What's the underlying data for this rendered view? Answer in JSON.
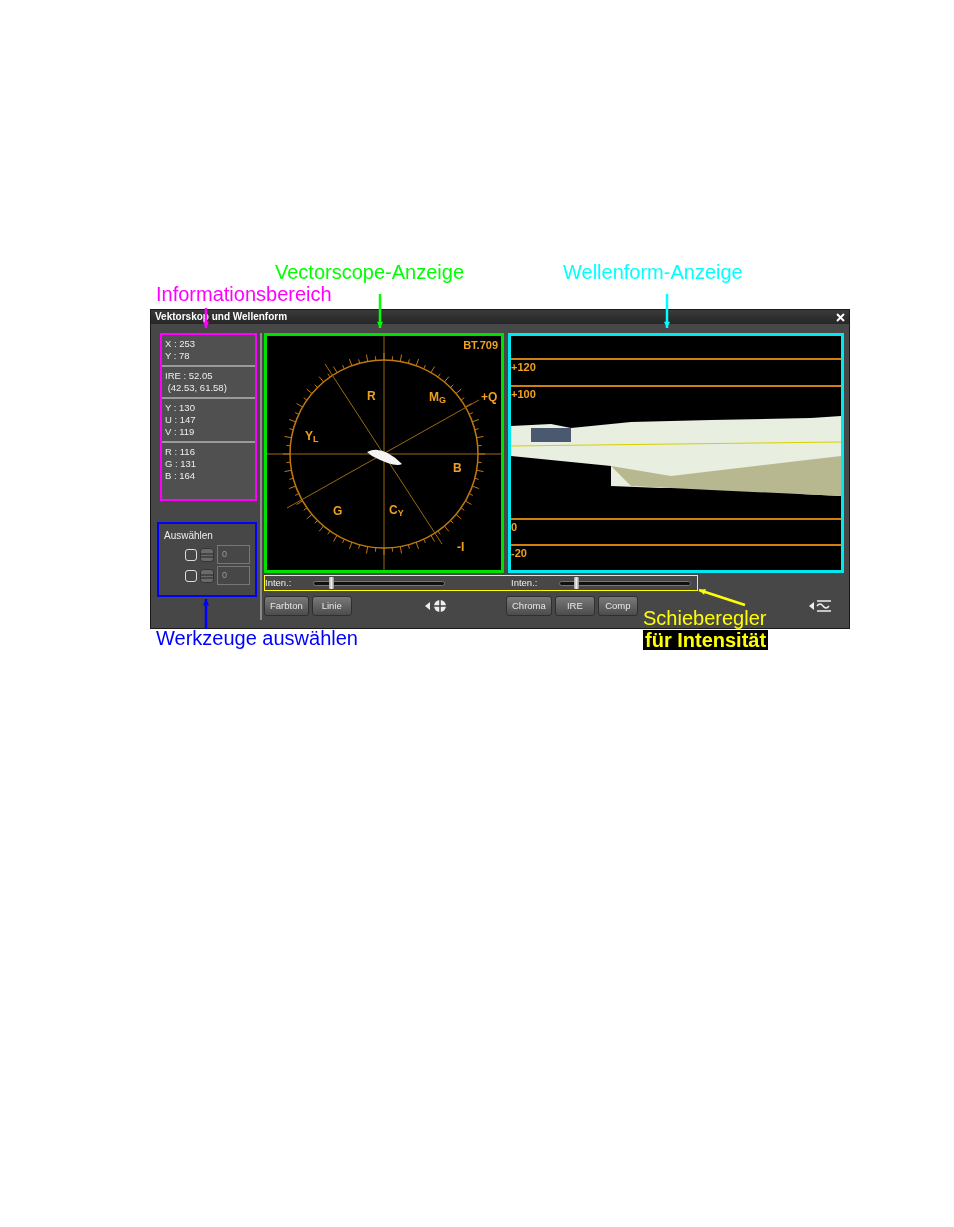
{
  "annotations": [
    {
      "kind": "info",
      "text": "Informationsbereich"
    },
    {
      "kind": "vector",
      "text": "Vectorscope-Anzeige"
    },
    {
      "kind": "wave",
      "text": "Wellenform-Anzeige"
    },
    {
      "kind": "tools",
      "text": "Werkzeuge auswählen"
    },
    {
      "kind": "slider",
      "text": "Schieberegler"
    },
    {
      "kind": "slider2",
      "text": "für Intensität"
    }
  ],
  "window": {
    "title": "Vektorskop und Wellenform"
  },
  "info": {
    "groups": [
      [
        "X : 253",
        "Y : 78"
      ],
      [
        "IRE : 52.05",
        " (42.53, 61.58)"
      ],
      [
        "Y : 130",
        "U : 147",
        "V : 119"
      ],
      [
        "R : 116",
        "G : 131",
        "B : 164"
      ]
    ]
  },
  "tools": {
    "title": "Auswählen",
    "rows": [
      {
        "checked": false,
        "value": "0"
      },
      {
        "checked": false,
        "value": "0"
      }
    ]
  },
  "vectorscope": {
    "standard": "BT.709",
    "labels": [
      "R",
      "M$_{G}$",
      "+Q",
      "Y$_{L}$",
      "B",
      "G",
      "C$_{Y}$",
      "-I"
    ]
  },
  "waveform": {
    "scale": [
      "+120",
      "+100",
      "0",
      "-20"
    ]
  },
  "sliders": [
    {
      "label": "Inten.:",
      "level": 0.14
    },
    {
      "label": "Inten.:",
      "level": 0.13
    }
  ],
  "vectorscope_buttons": [
    "Farbton",
    "Linie"
  ],
  "waveform_buttons": [
    "Chroma",
    "IRE",
    "Comp"
  ]
}
